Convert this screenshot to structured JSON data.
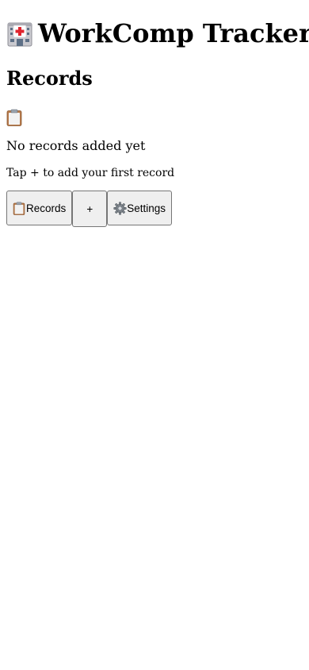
{
  "header": {
    "icon": "hospital-icon",
    "title": "WorkComp Tracker"
  },
  "section": {
    "title": "Records"
  },
  "empty_state": {
    "icon": "clipboard-icon",
    "title": "No records added yet",
    "hint": "Tap + to add your first record"
  },
  "nav": {
    "records": {
      "icon": "clipboard-icon",
      "label": "Records"
    },
    "add": {
      "label": "+"
    },
    "settings": {
      "icon": "gear-icon",
      "label": "Settings"
    }
  }
}
